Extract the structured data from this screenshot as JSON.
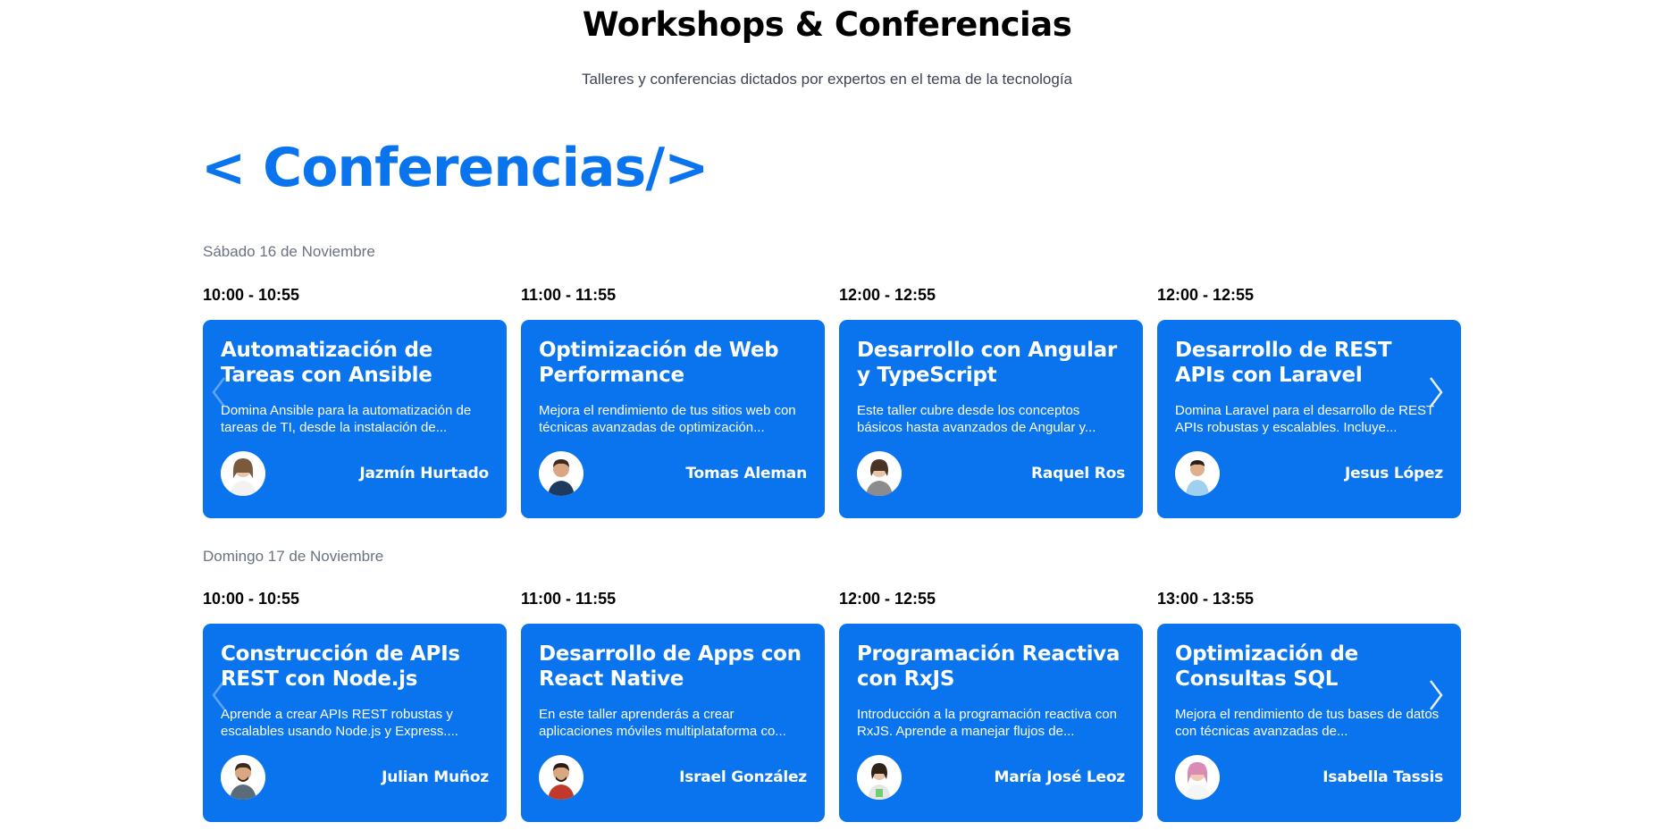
{
  "header": {
    "title": "Workshops & Conferencias",
    "subtitle": "Talleres y conferencias dictados por expertos en el tema de la tecnología"
  },
  "section": {
    "heading": "< Conferencias/>"
  },
  "colors": {
    "accent": "#0a74ef",
    "card_text": "#ffffff",
    "muted": "#6b7280"
  },
  "days": [
    {
      "label": "Sábado 16 de Noviembre",
      "sessions": [
        {
          "time": "10:00 - 10:55",
          "title": "Automatización de Tareas con Ansible",
          "description": "Domina Ansible para la automatización de tareas de TI, desde la instalación de...",
          "speaker": "Jazmín Hurtado",
          "avatar_icon": "female-avatar-icon"
        },
        {
          "time": "11:00 - 11:55",
          "title": "Optimización de Web Performance",
          "description": "Mejora el rendimiento de tus sitios web con técnicas avanzadas de optimización...",
          "speaker": "Tomas Aleman",
          "avatar_icon": "male-avatar-icon"
        },
        {
          "time": "12:00 - 12:55",
          "title": "Desarrollo con Angular y TypeScript",
          "description": "Este taller cubre desde los conceptos básicos hasta avanzados de Angular y...",
          "speaker": "Raquel Ros",
          "avatar_icon": "female-avatar-icon"
        },
        {
          "time": "12:00 - 12:55",
          "title": "Desarrollo de REST APIs con Laravel",
          "description": "Domina Laravel para el desarrollo de REST APIs robustas y escalables. Incluye...",
          "speaker": "Jesus López",
          "avatar_icon": "male-avatar-icon"
        }
      ]
    },
    {
      "label": "Domingo 17 de Noviembre",
      "sessions": [
        {
          "time": "10:00 - 10:55",
          "title": "Construcción de APIs REST con Node.js",
          "description": "Aprende a crear APIs REST robustas y escalables usando Node.js y Express....",
          "speaker": "Julian Muñoz",
          "avatar_icon": "male-avatar-icon"
        },
        {
          "time": "11:00 - 11:55",
          "title": "Desarrollo de Apps con React Native",
          "description": "En este taller aprenderás a crear aplicaciones móviles multiplataforma co...",
          "speaker": "Israel González",
          "avatar_icon": "male-avatar-icon"
        },
        {
          "time": "12:00 - 12:55",
          "title": "Programación Reactiva con RxJS",
          "description": "Introducción a la programación reactiva con RxJS. Aprende a manejar flujos de...",
          "speaker": "María José Leoz",
          "avatar_icon": "female-avatar-icon"
        },
        {
          "time": "13:00 - 13:55",
          "title": "Optimización de Consultas SQL",
          "description": "Mejora el rendimiento de tus bases de datos con técnicas avanzadas de...",
          "speaker": "Isabella Tassis",
          "avatar_icon": "female-avatar-icon"
        }
      ]
    }
  ]
}
